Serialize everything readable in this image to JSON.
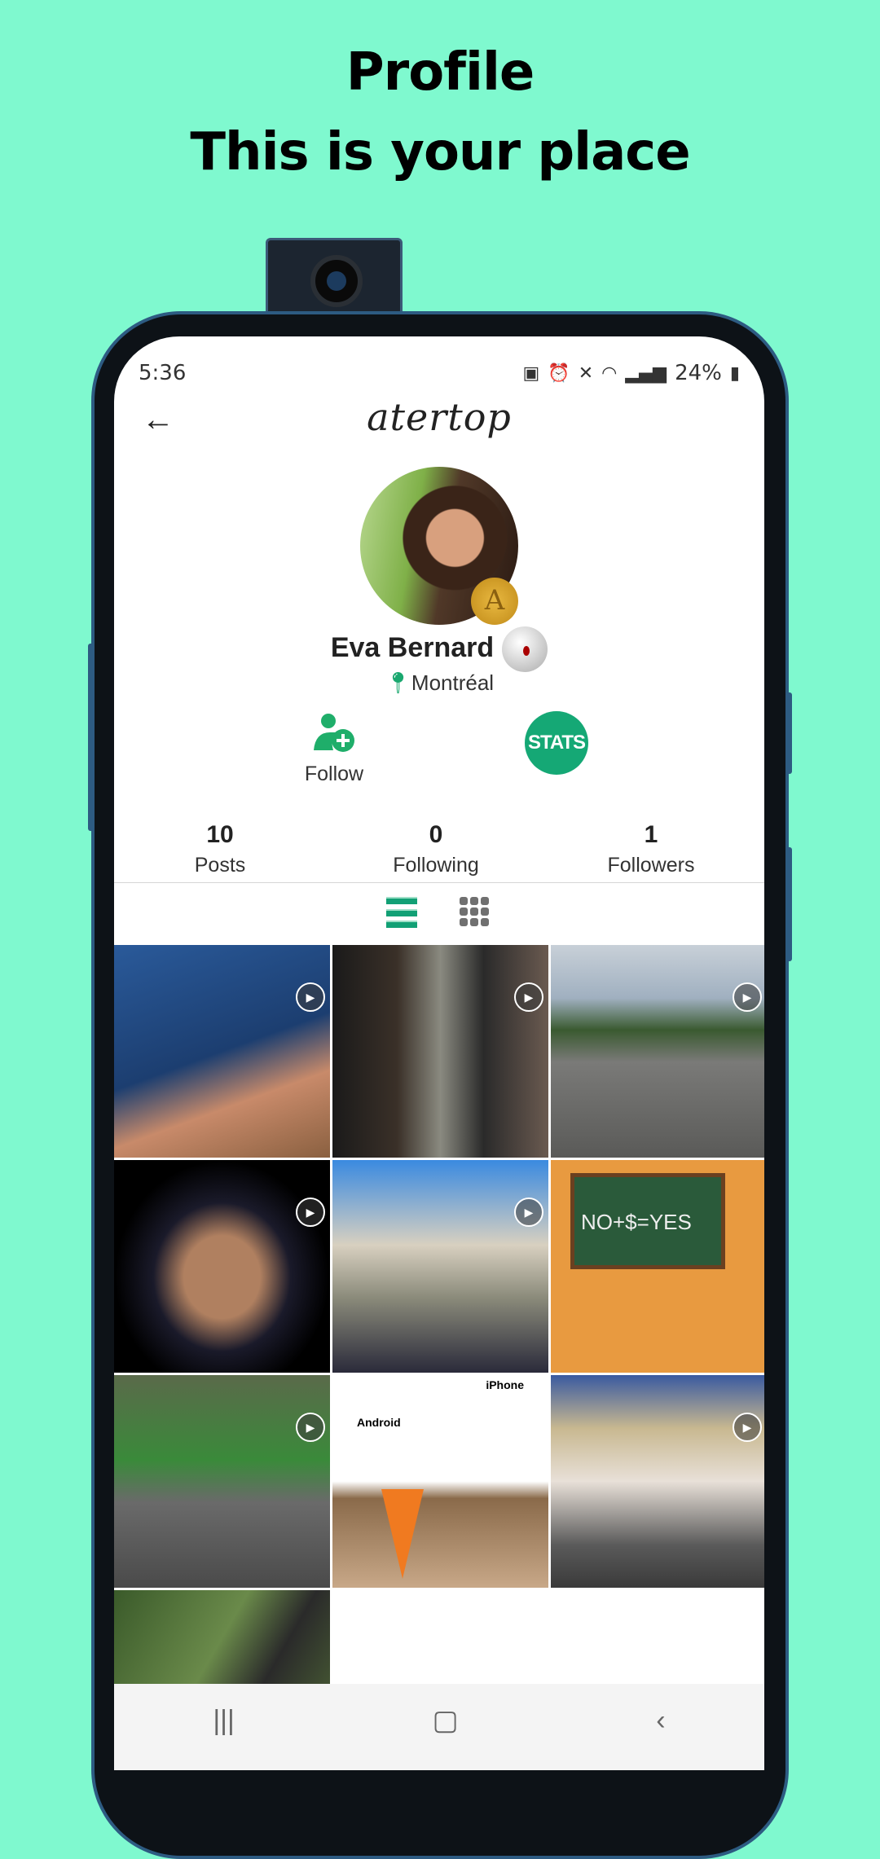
{
  "promo": {
    "line1": "Profile",
    "line2": "This is your place"
  },
  "status_bar": {
    "time": "5:36",
    "battery": "24%",
    "icons": [
      "battery-saver-icon",
      "alarm-icon",
      "mute-icon",
      "wifi-icon",
      "signal-icon",
      "battery-icon"
    ]
  },
  "header": {
    "app_name": "atertop",
    "back_icon": "arrow-left-icon"
  },
  "profile": {
    "name": "Eva Bernard",
    "location": "Montréal",
    "badge": "A"
  },
  "actions": {
    "follow_label": "Follow",
    "stats_label": "STATS"
  },
  "counts": [
    {
      "value": "10",
      "label": "Posts"
    },
    {
      "value": "0",
      "label": "Following"
    },
    {
      "value": "1",
      "label": "Followers"
    }
  ],
  "view_toggle": {
    "active": "list",
    "options": [
      "list",
      "grid"
    ]
  },
  "accent_color": "#15a875",
  "posts": [
    {
      "type": "video",
      "caption": ""
    },
    {
      "type": "video",
      "caption": ""
    },
    {
      "type": "video",
      "caption": ""
    },
    {
      "type": "video",
      "caption": ""
    },
    {
      "type": "video",
      "caption": ""
    },
    {
      "type": "image",
      "caption": "NO+$=YES"
    },
    {
      "type": "video",
      "caption": ""
    },
    {
      "type": "image",
      "caption_left": "Android",
      "caption_right": "iPhone"
    },
    {
      "type": "video",
      "caption": ""
    },
    {
      "type": "image",
      "caption": ""
    }
  ],
  "nav": {
    "recent": "|||",
    "home": "▢",
    "back": "‹"
  }
}
